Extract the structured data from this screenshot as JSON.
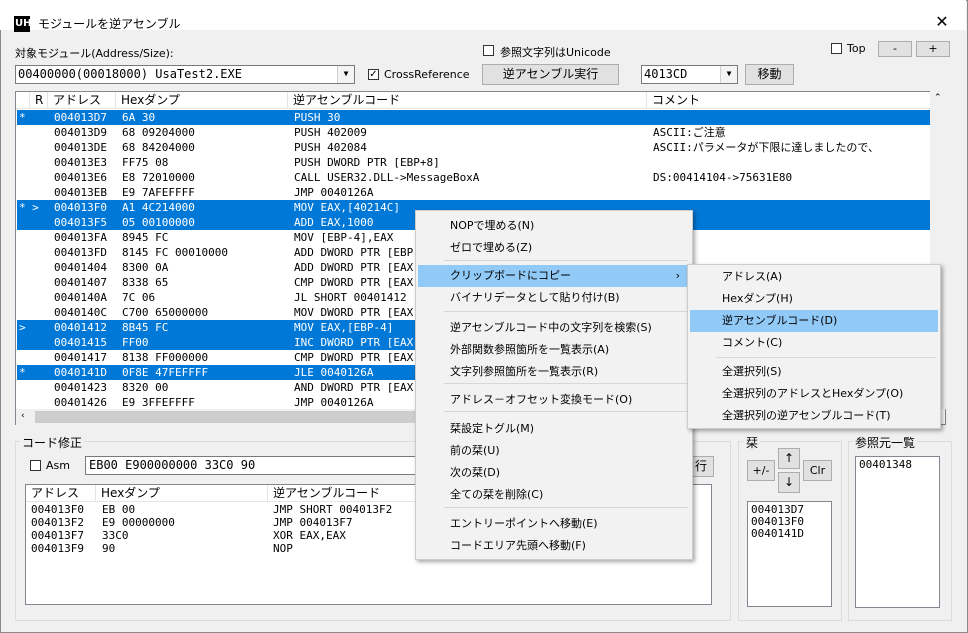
{
  "window": {
    "title": "モジュールを逆アセンブル",
    "icon_label": "UH",
    "close_icon": "close-icon"
  },
  "top": {
    "module_label": "対象モジュール(Address/Size):",
    "module_value": "00400000(00018000) UsaTest2.EXE",
    "unicode_label": "参照文字列はUnicode",
    "top_label": "Top",
    "minus_label": "-",
    "plus_label": "+",
    "crossref_label": "CrossReference",
    "crossref_checked": true,
    "disasm_button": "逆アセンブル実行",
    "address_value": "4013CD",
    "move_button": "移動"
  },
  "list": {
    "headers": [
      "R",
      "アドレス",
      "Hexダンプ",
      "逆アセンブルコード",
      "コメント"
    ],
    "rows": [
      {
        "r": "*",
        "addr": "004013D7",
        "hex": "6A 30",
        "code": "PUSH 30",
        "comment": "",
        "sel": true
      },
      {
        "r": "",
        "addr": "004013D9",
        "hex": "68 09204000",
        "code": "PUSH 402009",
        "comment": "ASCII:ご注意",
        "sel": false
      },
      {
        "r": "",
        "addr": "004013DE",
        "hex": "68 84204000",
        "code": "PUSH 402084",
        "comment": "ASCII:パラメータが下限に達しましたので、",
        "sel": false
      },
      {
        "r": "",
        "addr": "004013E3",
        "hex": "FF75 08",
        "code": "PUSH DWORD PTR [EBP+8]",
        "comment": "",
        "sel": false
      },
      {
        "r": "",
        "addr": "004013E6",
        "hex": "E8 72010000",
        "code": "CALL USER32.DLL->MessageBoxA",
        "comment": "DS:00414104->75631E80",
        "sel": false
      },
      {
        "r": "",
        "addr": "004013EB",
        "hex": "E9 7AFEFFFF",
        "code": "JMP 0040126A",
        "comment": "",
        "sel": false
      },
      {
        "r": "* >",
        "addr": "004013F0",
        "hex": "A1 4C214000",
        "code": "MOV EAX,[40214C]",
        "comment": "",
        "sel": true
      },
      {
        "r": "",
        "addr": "004013F5",
        "hex": "05 00100000",
        "code": "ADD EAX,1000",
        "comment": "",
        "sel": true
      },
      {
        "r": "",
        "addr": "004013FA",
        "hex": "8945 FC",
        "code": "MOV [EBP-4],EAX",
        "comment": "",
        "sel": false
      },
      {
        "r": "",
        "addr": "004013FD",
        "hex": "8145 FC 00010000",
        "code": "ADD DWORD PTR [EBP",
        "comment": "",
        "sel": false
      },
      {
        "r": "",
        "addr": "00401404",
        "hex": "8300 0A",
        "code": "ADD DWORD PTR [EAX",
        "comment": "",
        "sel": false
      },
      {
        "r": "",
        "addr": "00401407",
        "hex": "8338 65",
        "code": "CMP DWORD PTR [EAX",
        "comment": "",
        "sel": false
      },
      {
        "r": "",
        "addr": "0040140A",
        "hex": "7C 06",
        "code": "JL SHORT 00401412",
        "comment": "",
        "sel": false
      },
      {
        "r": "",
        "addr": "0040140C",
        "hex": "C700 65000000",
        "code": "MOV DWORD PTR [EAX",
        "comment": "",
        "sel": false
      },
      {
        "r": ">",
        "addr": "00401412",
        "hex": "8B45 FC",
        "code": "MOV EAX,[EBP-4]",
        "comment": "",
        "sel": true
      },
      {
        "r": "",
        "addr": "00401415",
        "hex": "FF00",
        "code": "INC DWORD PTR [EAX",
        "comment": "",
        "sel": true
      },
      {
        "r": "",
        "addr": "00401417",
        "hex": "8138 FF000000",
        "code": "CMP DWORD PTR [EAX",
        "comment": "",
        "sel": false
      },
      {
        "r": "*",
        "addr": "0040141D",
        "hex": "0F8E 47FEFFFF",
        "code": "JLE 0040126A",
        "comment": "",
        "sel": true
      },
      {
        "r": "",
        "addr": "00401423",
        "hex": "8320 00",
        "code": "AND DWORD PTR [EAX",
        "comment": "",
        "sel": false
      },
      {
        "r": "",
        "addr": "00401426",
        "hex": "E9 3FFEFFFF",
        "code": "JMP 0040126A",
        "comment": "",
        "sel": false
      }
    ]
  },
  "code_edit": {
    "group_label": "コード修正",
    "asm_label": "Asm",
    "hex_input": "EB00 E900000000 33C0 90",
    "exec_button": "行",
    "headers": [
      "アドレス",
      "Hexダンプ",
      "逆アセンブルコード"
    ],
    "rows": [
      {
        "addr": "004013F0",
        "hex": "EB 00",
        "code": "JMP SHORT 004013F2"
      },
      {
        "addr": "004013F2",
        "hex": "E9 00000000",
        "code": "JMP 004013F7"
      },
      {
        "addr": "004013F7",
        "hex": "33C0",
        "code": "XOR EAX,EAX"
      },
      {
        "addr": "004013F9",
        "hex": "90",
        "code": "NOP"
      }
    ]
  },
  "bookmarks": {
    "group_label": "栞",
    "up_label": "↑",
    "down_label": "↓",
    "toggle_label": "+/-",
    "clear_label": "Clr",
    "items": [
      "004013D7",
      "004013F0",
      "0040141D"
    ]
  },
  "refs": {
    "group_label": "参照元一覧",
    "items": [
      "00401348"
    ]
  },
  "context_menu": {
    "items": [
      {
        "label": "NOPで埋める(N)"
      },
      {
        "label": "ゼロで埋める(Z)"
      },
      {
        "label": "クリップボードにコピー",
        "submenu": true,
        "highlight": true
      },
      {
        "label": "バイナリデータとして貼り付け(B)"
      },
      {
        "label": "逆アセンブルコード中の文字列を検索(S)"
      },
      {
        "label": "外部関数参照箇所を一覧表示(A)"
      },
      {
        "label": "文字列参照箇所を一覧表示(R)"
      },
      {
        "label": "アドレス－オフセット変換モード(O)"
      },
      {
        "label": "栞設定トグル(M)"
      },
      {
        "label": "前の栞(U)"
      },
      {
        "label": "次の栞(D)"
      },
      {
        "label": "全ての栞を削除(C)"
      },
      {
        "label": "エントリーポイントへ移動(E)"
      },
      {
        "label": "コードエリア先頭へ移動(F)"
      }
    ],
    "submenu_arrow": "›"
  },
  "sub_menu": {
    "items": [
      {
        "label": "アドレス(A)"
      },
      {
        "label": "Hexダンプ(H)"
      },
      {
        "label": "逆アセンブルコード(D)",
        "highlight": true
      },
      {
        "label": "コメント(C)"
      },
      {
        "label": "全選択列(S)"
      },
      {
        "label": "全選択列のアドレスとHexダンプ(O)"
      },
      {
        "label": "全選択列の逆アセンブルコード(T)"
      }
    ]
  },
  "colors": {
    "selection": "#0078d7",
    "menu_highlight": "#91c9f7"
  }
}
